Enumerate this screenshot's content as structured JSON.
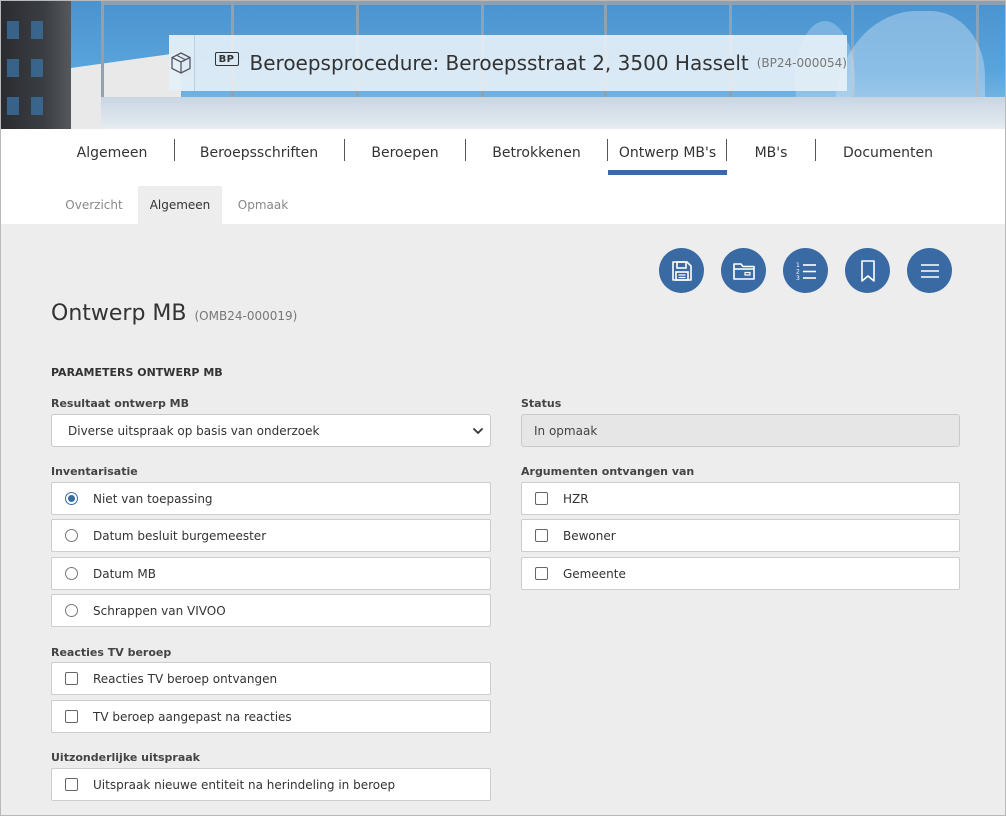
{
  "header": {
    "badge": "BP",
    "title": "Beroepsprocedure: Beroepsstraat 2, 3500 Hasselt",
    "code": "(BP24-000054)",
    "icon": "package-box-icon"
  },
  "main_tabs": [
    {
      "label": "Algemeen",
      "active": false
    },
    {
      "label": "Beroepsschriften",
      "active": false
    },
    {
      "label": "Beroepen",
      "active": false
    },
    {
      "label": "Betrokkenen",
      "active": false
    },
    {
      "label": "Ontwerp MB's",
      "active": true
    },
    {
      "label": "MB's",
      "active": false
    },
    {
      "label": "Documenten",
      "active": false
    }
  ],
  "sub_tabs": [
    {
      "label": "Overzicht",
      "active": false
    },
    {
      "label": "Algemeen",
      "active": true
    },
    {
      "label": "Opmaak",
      "active": false
    }
  ],
  "actions": [
    {
      "name": "save",
      "icon": "floppy-disk-icon"
    },
    {
      "name": "folder",
      "icon": "folder-icon"
    },
    {
      "name": "numbered-list",
      "icon": "numbered-list-icon"
    },
    {
      "name": "bookmark",
      "icon": "bookmark-icon"
    },
    {
      "name": "menu",
      "icon": "hamburger-menu-icon"
    }
  ],
  "page": {
    "title": "Ontwerp MB",
    "code": "(OMB24-000019)"
  },
  "form": {
    "section_title": "PARAMETERS ONTWERP MB",
    "resultaat": {
      "label": "Resultaat ontwerp MB",
      "value": "Diverse uitspraak op basis van onderzoek"
    },
    "status": {
      "label": "Status",
      "value": "In opmaak"
    },
    "inventarisatie": {
      "label": "Inventarisatie",
      "options": [
        {
          "label": "Niet van toepassing",
          "selected": true
        },
        {
          "label": "Datum besluit burgemeester",
          "selected": false
        },
        {
          "label": "Datum MB",
          "selected": false
        },
        {
          "label": "Schrappen van VIVOO",
          "selected": false
        }
      ]
    },
    "argumenten": {
      "label": "Argumenten ontvangen van",
      "options": [
        {
          "label": "HZR",
          "checked": false
        },
        {
          "label": "Bewoner",
          "checked": false
        },
        {
          "label": "Gemeente",
          "checked": false
        }
      ]
    },
    "reacties": {
      "label": "Reacties TV beroep",
      "options": [
        {
          "label": "Reacties TV beroep ontvangen",
          "checked": false
        },
        {
          "label": "TV beroep aangepast na reacties",
          "checked": false
        }
      ]
    },
    "uitzonderlijk": {
      "label": "Uitzonderlijke uitspraak",
      "options": [
        {
          "label": "Uitspraak nieuwe entiteit na herindeling in beroep",
          "checked": false
        }
      ]
    }
  },
  "colors": {
    "accent": "#3a6aa3",
    "content_bg": "#ededed",
    "border": "#cdcdcd"
  }
}
